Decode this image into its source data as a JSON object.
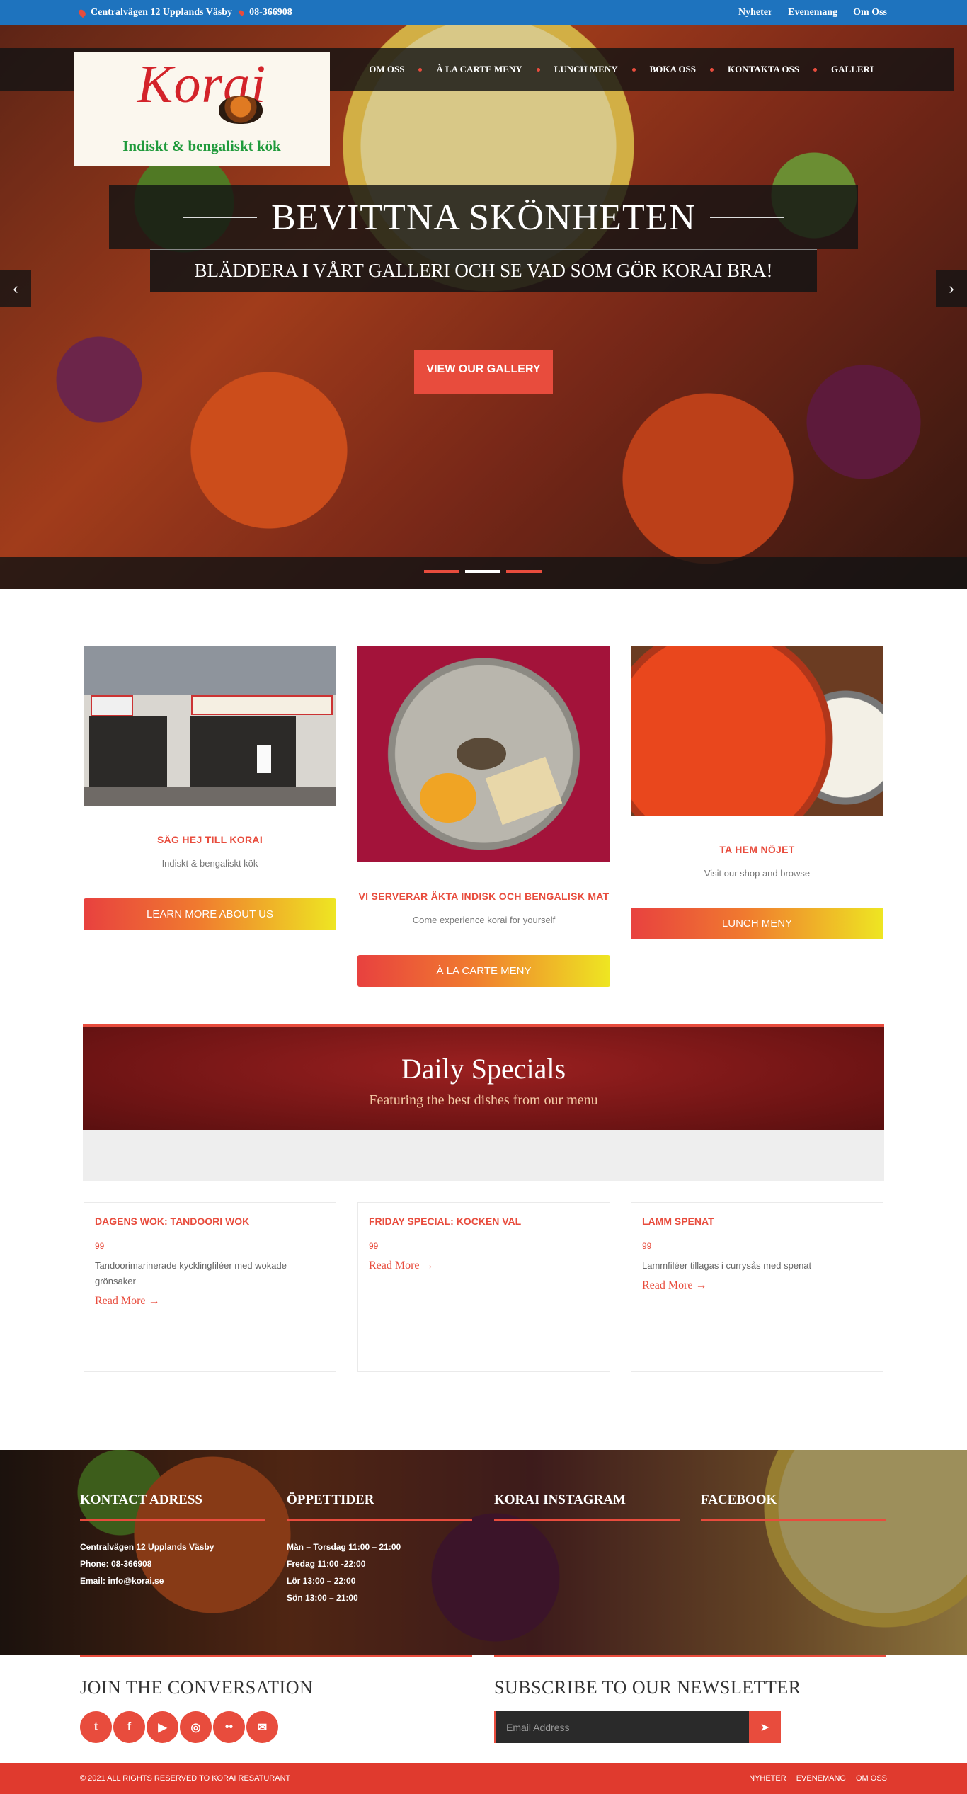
{
  "topbar": {
    "address": "Centralvägen 12 Upplands Väsby",
    "phone": "08-366908",
    "links": [
      "Nyheter",
      "Evenemang",
      "Om Oss"
    ]
  },
  "logo": {
    "name": "Korai",
    "tagline": "Indiskt & bengaliskt kök"
  },
  "nav": [
    "OM OSS",
    "À LA CARTE MENY",
    "LUNCH MENY",
    "BOKA OSS",
    "KONTAKTA OSS",
    "GALLERI"
  ],
  "hero": {
    "title": "BEVITTNA SKÖNHETEN",
    "subtitle": "BLÄDDERA I VÅRT GALLERI OCH SE VAD SOM GÖR KORAI BRA!",
    "button": "VIEW OUR GALLERY",
    "prev_icon": "chevron-left-icon",
    "next_icon": "chevron-right-icon"
  },
  "features": [
    {
      "title": "SÄG HEJ TILL KORAI",
      "desc": "Indiskt & bengaliskt kök",
      "button": "LEARN MORE ABOUT US"
    },
    {
      "title": "VI SERVERAR ÄKTA INDISK OCH BENGALISK MAT",
      "desc": "Come experience korai for yourself",
      "button": "À LA CARTE MENY"
    },
    {
      "title": "TA HEM NÖJET",
      "desc": "Visit our shop and browse",
      "button": "LUNCH MENY"
    }
  ],
  "specials": {
    "title": "Daily Specials",
    "subtitle": "Featuring the best dishes from our menu",
    "items": [
      {
        "title": "DAGENS WOK: TANDOORI WOK",
        "price": "99",
        "desc": "Tandoorimarinerade kycklingfiléer med wokade grönsaker",
        "more": "Read More →"
      },
      {
        "title": "FRIDAY SPECIAL: KOCKEN VAL",
        "price": "99",
        "desc": "",
        "more": "Read More →"
      },
      {
        "title": "LAMM SPENAT",
        "price": "99",
        "desc": "Lammfiléer tillagas i currysås med spenat",
        "more": "Read More →"
      }
    ]
  },
  "footer": {
    "contact": {
      "title": "KONTACT ADRESS",
      "lines": [
        "Centralvägen 12 Upplands Väsby",
        "Phone: 08-366908",
        "Email: info@korai.se"
      ]
    },
    "hours": {
      "title": "ÖPPETTIDER",
      "lines": [
        "Mån – Torsdag 11:00 – 21:00",
        "Fredag 11:00 -22:00",
        "Lör 13:00 – 22:00",
        "Sön 13:00 – 21:00"
      ]
    },
    "instagram": {
      "title": "KORAI INSTAGRAM"
    },
    "facebook": {
      "title": "FACEBOOK"
    },
    "join": {
      "title": "JOIN THE CONVERSATION",
      "icons": [
        "twitter-icon",
        "facebook-icon",
        "youtube-icon",
        "instagram-icon",
        "flickr-icon",
        "email-icon"
      ]
    },
    "newsletter": {
      "title": "SUBSCRIBE TO OUR NEWSLETTER",
      "placeholder": "Email Address"
    },
    "copyright": "© 2021 ALL RIGHTS RESERVED TO KORAI RESATURANT",
    "links": [
      "NYHETER",
      "EVENEMANG",
      "OM OSS"
    ]
  },
  "colors": {
    "accent": "#e84c3d",
    "topbar": "#1e73be",
    "footer_bar": "#e03a2e",
    "logo_red": "#d3232a",
    "logo_green": "#1f9a3b"
  }
}
